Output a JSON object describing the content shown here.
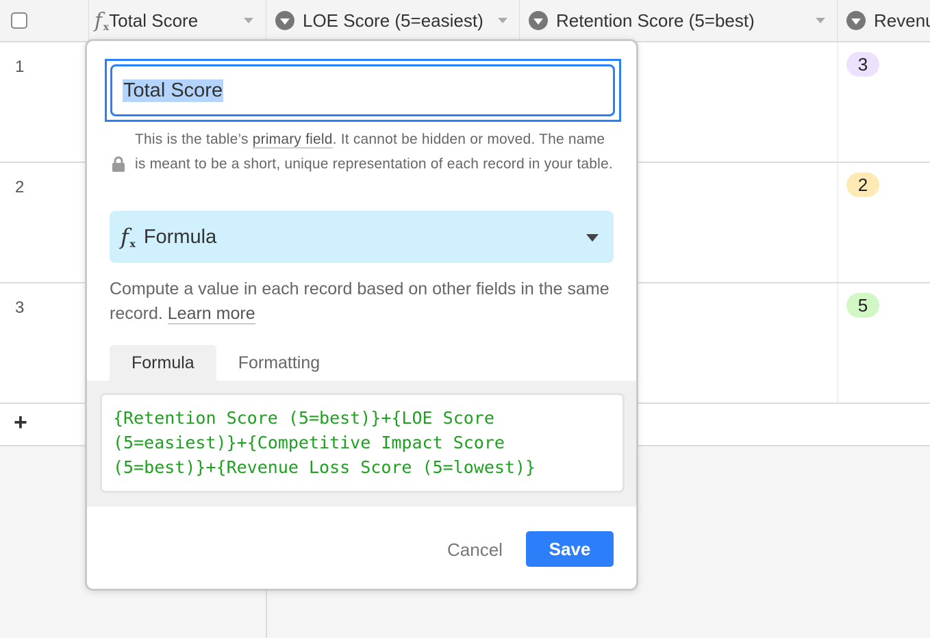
{
  "header": {
    "columns": [
      {
        "label": "Total Score",
        "icon": "formula-icon"
      },
      {
        "label": "LOE Score (5=easiest)",
        "icon": "single-select-icon"
      },
      {
        "label": "Retention Score (5=best)",
        "icon": "single-select-icon"
      },
      {
        "label": "Revenu",
        "icon": "single-select-icon"
      }
    ]
  },
  "rows": [
    {
      "number": "1",
      "revenue_badge": "3",
      "badge_color": "#ede2fe"
    },
    {
      "number": "2",
      "revenue_badge": "2",
      "badge_color": "#ffeab6"
    },
    {
      "number": "3",
      "revenue_badge": "5",
      "badge_color": "#d1f7c4"
    }
  ],
  "add_row": {
    "label": "+"
  },
  "popup": {
    "field_name": "Total Score",
    "primary_note": {
      "prefix": "This is the table’s ",
      "link": "primary field",
      "suffix": ". It cannot be hidden or moved. The name is meant to be a short, unique representation of each record in your table."
    },
    "field_type": {
      "icon": "fx",
      "label": "Formula"
    },
    "description": {
      "text": "Compute a value in each record based on other fields in the same record. ",
      "link": "Learn more"
    },
    "tabs": [
      {
        "label": "Formula",
        "active": true
      },
      {
        "label": "Formatting",
        "active": false
      }
    ],
    "formula": "{Retention Score (5=best)}+{LOE Score (5=easiest)}+{Competitive Impact Score (5=best)}+{Revenue Loss Score (5=lowest)}",
    "cancel_label": "Cancel",
    "save_label": "Save"
  },
  "colors": {
    "accent": "#2d7ff9",
    "type_bg": "#d0f0fd",
    "formula_text": "#20a020"
  }
}
